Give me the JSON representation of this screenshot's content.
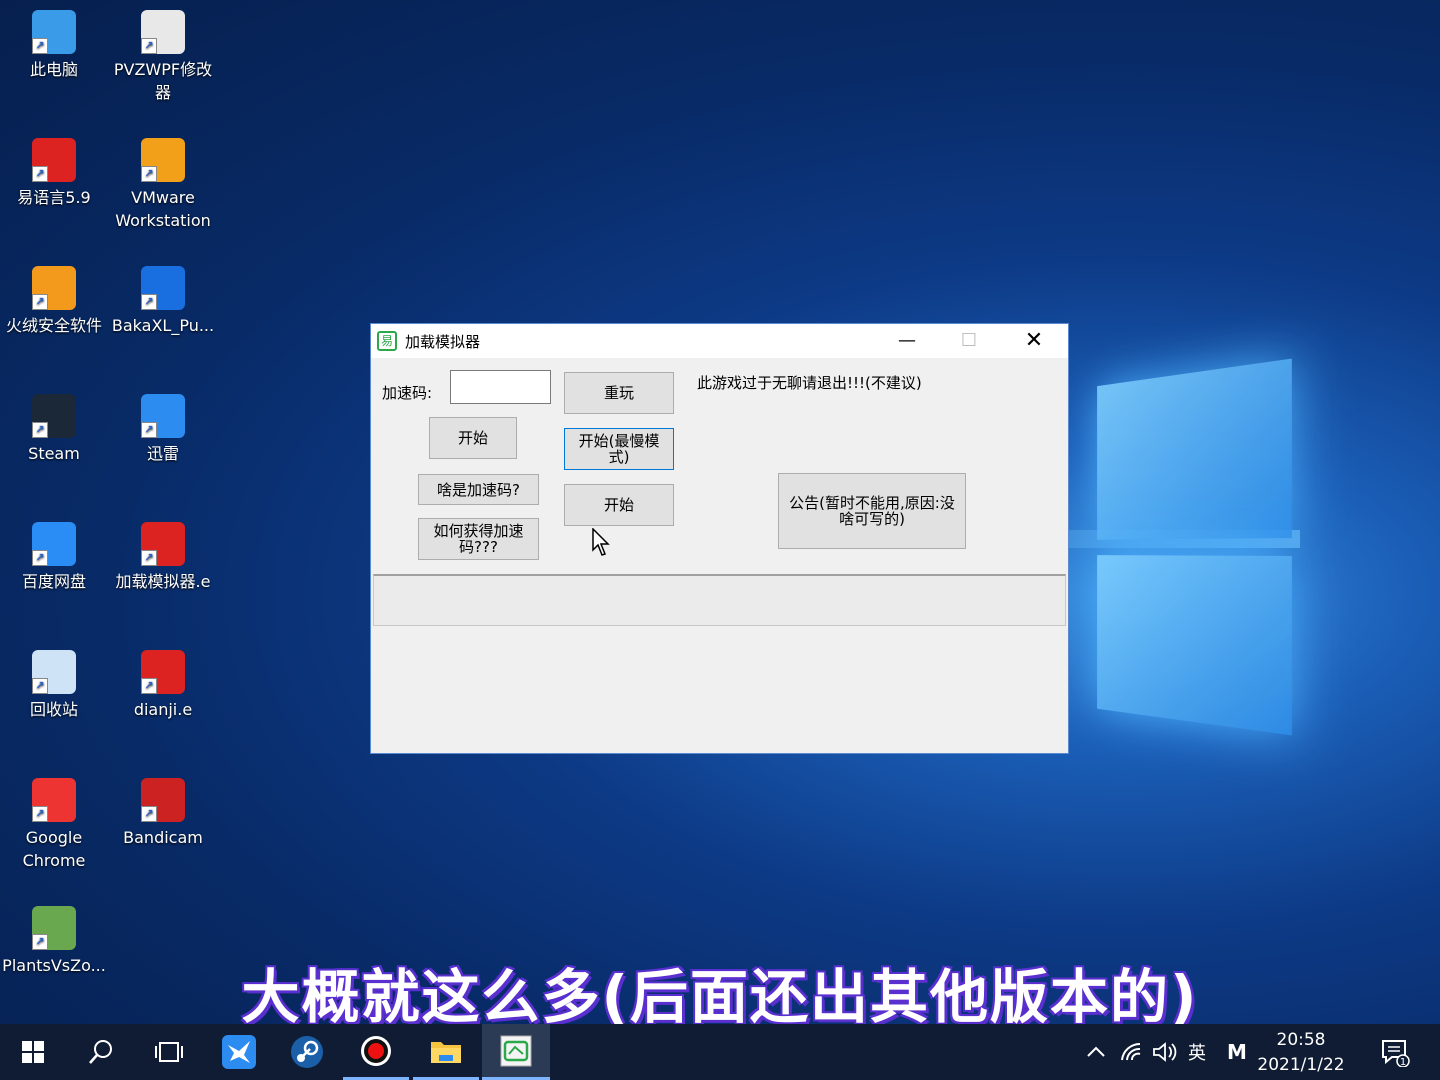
{
  "desktop": {
    "icons": [
      {
        "label": "此电脑",
        "icon": "computer-icon",
        "color": "#3a9be8"
      },
      {
        "label": "PVZWPF修改器",
        "icon": "app-window-icon",
        "color": "#e8e8e8"
      },
      {
        "label": "易语言5.9",
        "icon": "eyuyan-icon",
        "color": "#d22"
      },
      {
        "label": "VMware Workstation",
        "icon": "vmware-icon",
        "color": "#f2a01a"
      },
      {
        "label": "火绒安全软件",
        "icon": "huorong-icon",
        "color": "#f39a1c"
      },
      {
        "label": "BakaXL_Pu...",
        "icon": "bakaxl-icon",
        "color": "#1a6fe0"
      },
      {
        "label": "Steam",
        "icon": "steam-icon",
        "color": "#1b2838"
      },
      {
        "label": "迅雷",
        "icon": "xunlei-icon",
        "color": "#2d8cf0"
      },
      {
        "label": "百度网盘",
        "icon": "baidu-netdisk-icon",
        "color": "#2a8cf5"
      },
      {
        "label": "加载模拟器.e",
        "icon": "eyuyan-file-icon",
        "color": "#d22"
      },
      {
        "label": "回收站",
        "icon": "recycle-bin-icon",
        "color": "#cfe3f7"
      },
      {
        "label": "dianji.e",
        "icon": "eyuyan-file-icon",
        "color": "#d22"
      },
      {
        "label": "Google Chrome",
        "icon": "chrome-icon",
        "color": "#e33"
      },
      {
        "label": "Bandicam",
        "icon": "bandicam-icon",
        "color": "#c22"
      },
      {
        "label": "PlantsVsZo...",
        "icon": "plants-vs-zombies-icon",
        "color": "#6aa84f"
      }
    ]
  },
  "window": {
    "title": "加载模拟器",
    "minimize": "—",
    "maximize": "☐",
    "close": "✕",
    "speed_code_label": "加速码:",
    "speed_code_value": "",
    "btn_start1": "开始",
    "btn_what_code": "啥是加速码?",
    "btn_how_get": "如何获得加速码???",
    "btn_replay": "重玩",
    "btn_slow_mode": "开始(最慢模式)",
    "btn_start2": "开始",
    "exit_text": "此游戏过于无聊请退出!!!(不建议)",
    "btn_notice": "公告(暂时不能用,原因:没啥可写的)"
  },
  "subtitle": "大概就这么多(后面还出其他版本的)",
  "taskbar": {
    "items": [
      "start-icon",
      "search-icon",
      "task-view-icon",
      "xunlei-icon",
      "steam-icon",
      "bandicam-icon",
      "file-explorer-icon",
      "emulator-app-icon"
    ],
    "tray_ime": "英",
    "tray_m": "M",
    "time": "20:58",
    "date": "2021/1/22",
    "notification_count": "1"
  }
}
